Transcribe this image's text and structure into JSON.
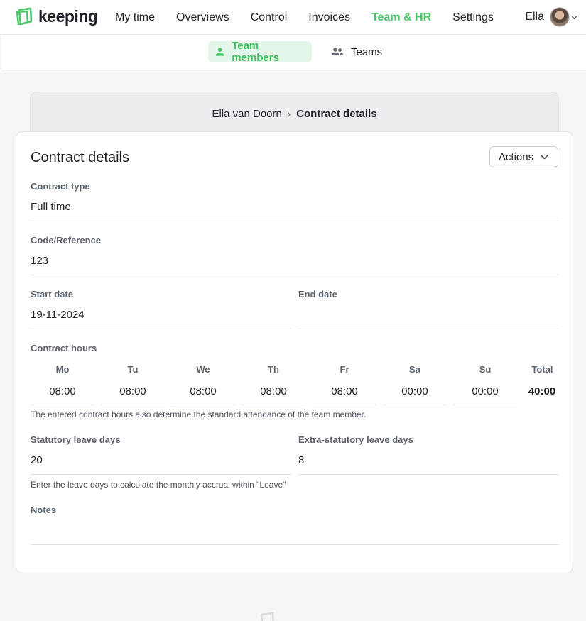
{
  "app": {
    "brand": "keeping",
    "nav": [
      "My time",
      "Overviews",
      "Control",
      "Invoices",
      "Team & HR",
      "Settings"
    ],
    "active_nav": "Team & HR",
    "user_name": "Ella",
    "accent_color": "#4cc76a"
  },
  "subnav": {
    "team_members": "Team members",
    "teams": "Teams"
  },
  "breadcrumb": {
    "person": "Ella van Doorn",
    "current": "Contract details"
  },
  "contract": {
    "title": "Contract details",
    "actions_label": "Actions",
    "contract_type_label": "Contract type",
    "contract_type_value": "Full time",
    "code_label": "Code/Reference",
    "code_value": "123",
    "start_date_label": "Start date",
    "start_date_value": "19-11-2024",
    "end_date_label": "End date",
    "end_date_value": "",
    "hours_label": "Contract hours",
    "days": [
      {
        "day": "Mo",
        "hours": "08:00"
      },
      {
        "day": "Tu",
        "hours": "08:00"
      },
      {
        "day": "We",
        "hours": "08:00"
      },
      {
        "day": "Th",
        "hours": "08:00"
      },
      {
        "day": "Fr",
        "hours": "08:00"
      },
      {
        "day": "Sa",
        "hours": "00:00"
      },
      {
        "day": "Su",
        "hours": "00:00"
      }
    ],
    "total_label": "Total",
    "total_value": "40:00",
    "hours_hint": "The entered contract hours also determine the standard attendance of the team member.",
    "statutory_label": "Statutory leave days",
    "statutory_value": "20",
    "extra_label": "Extra-statutory leave days",
    "extra_value": "8",
    "leave_hint": "Enter the leave days to calculate the monthly accrual within \"Leave\"",
    "notes_label": "Notes",
    "notes_value": ""
  }
}
